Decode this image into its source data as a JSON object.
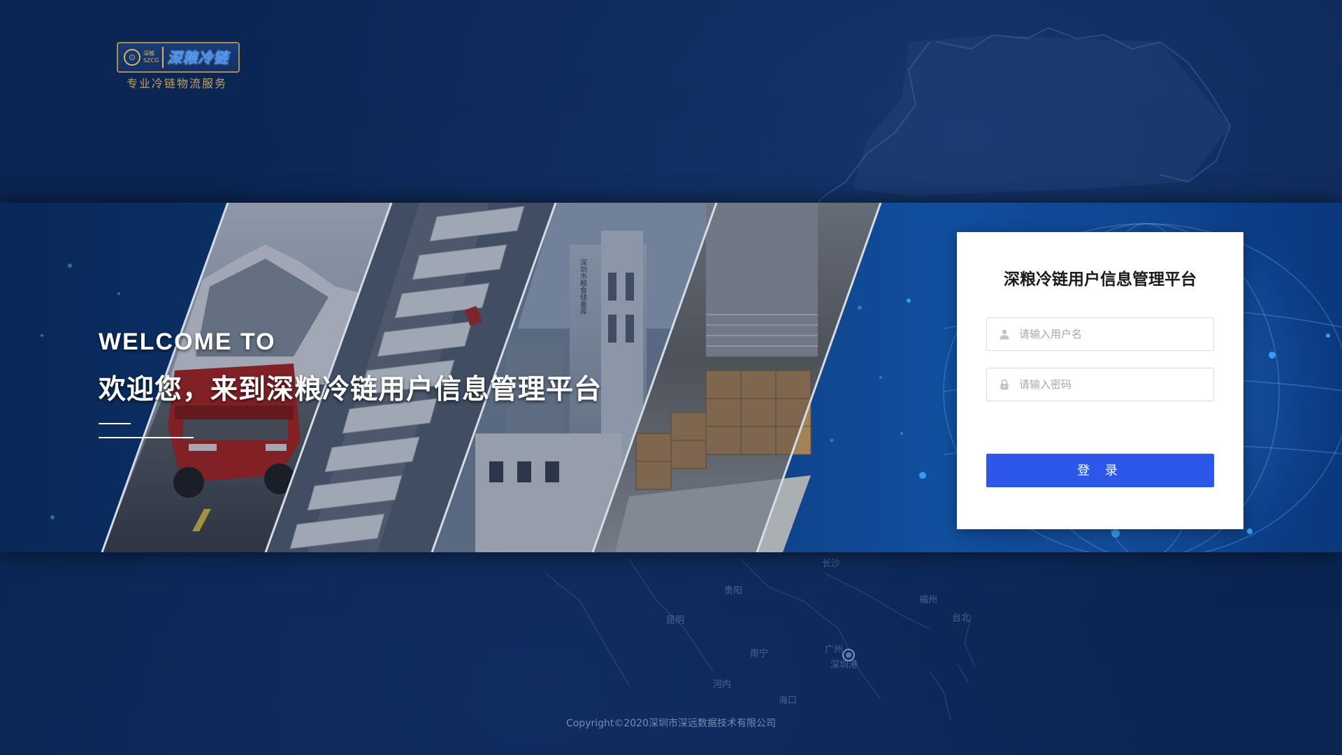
{
  "logo": {
    "small_cn": "深粮",
    "small_en": "SZCG",
    "main": "深粮冷链",
    "tagline": "专业冷链物流服务"
  },
  "map_labels": [
    "长沙",
    "贵阳",
    "昆明",
    "福州",
    "台北",
    "南宁",
    "广州",
    "深圳港",
    "河内",
    "海口"
  ],
  "banner": {
    "welcome_en": "WELCOME TO",
    "welcome_cn": "欢迎您，来到深粮冷链用户信息管理平台",
    "tower_text": "深圳市粮食储备库"
  },
  "login": {
    "title": "深粮冷链用户信息管理平台",
    "username_placeholder": "请输入用户名",
    "password_placeholder": "请输入密码",
    "submit_label": "登 录"
  },
  "footer": {
    "copyright": "Copyright©2020深圳市深远数据技术有限公司"
  },
  "colors": {
    "background": "#0b2553",
    "button": "#2c57e8",
    "logo_gold": "#c7a258",
    "logo_blue": "#3f8ef0"
  }
}
